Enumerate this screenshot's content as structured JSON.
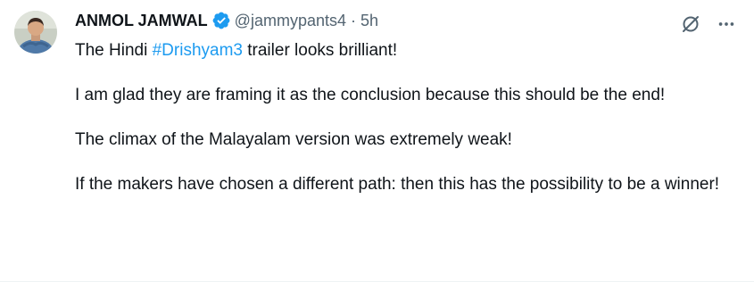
{
  "author": {
    "display_name": "ANMOL JAMWAL",
    "handle": "@jammypants4",
    "separator": "·",
    "time": "5h"
  },
  "icons": {
    "verified": "verified-badge-icon",
    "grok": "grok-icon",
    "more": "more-icon"
  },
  "colors": {
    "verified": "#1d9bf0",
    "hashtag": "#1d9bf0",
    "secondary_text": "#536471"
  },
  "tweet": {
    "line1_prefix": "The Hindi ",
    "hashtag": "#Drishyam3",
    "line1_suffix": " trailer looks brilliant!",
    "p2": "I am glad they are framing it as the conclusion because this should be the end!",
    "p3": "The climax of the Malayalam version was extremely weak!",
    "p4": "If the makers have chosen a different path: then this has the possibility to be a winner!"
  }
}
